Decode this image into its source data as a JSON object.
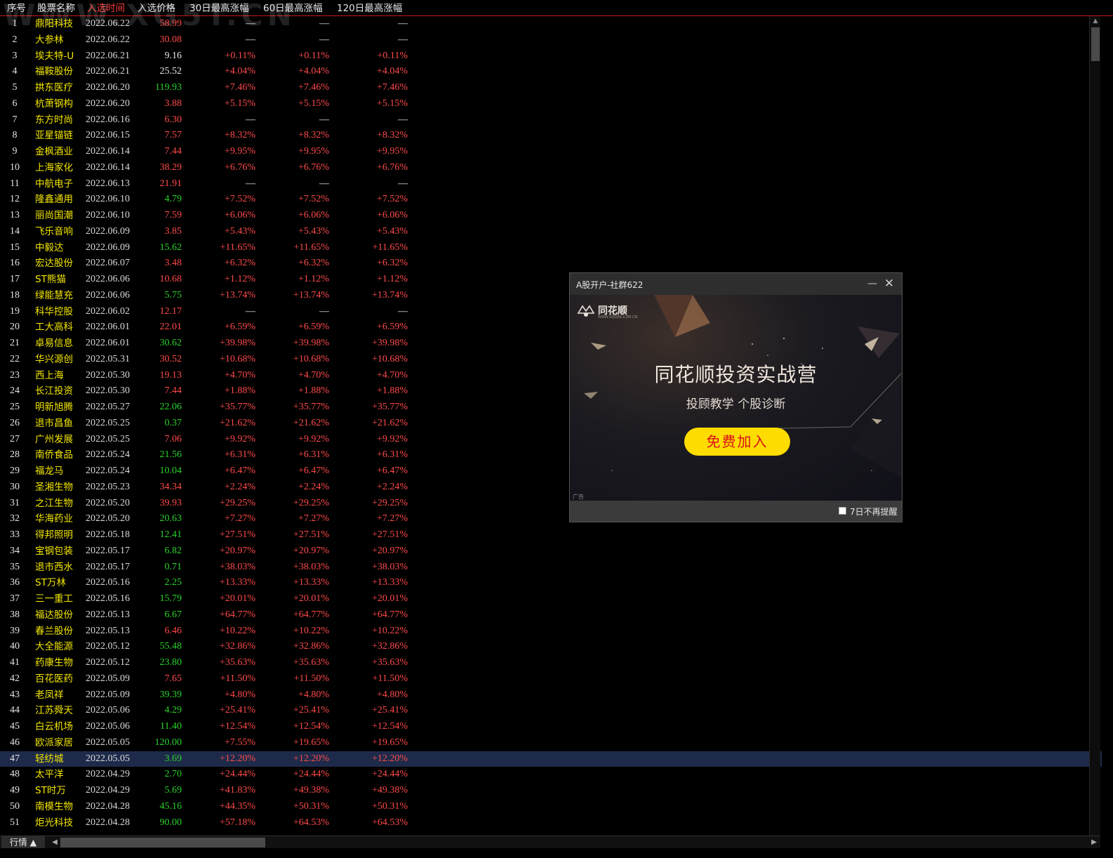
{
  "watermark": "WWW.XG5T.CN",
  "header": {
    "columns": [
      "序号",
      "股票名称",
      "入选时间",
      "入选价格",
      "30日最高涨幅",
      "60日最高涨幅",
      "120日最高涨幅"
    ]
  },
  "colors": {
    "up": "#ff4a4a",
    "down": "#2bd22b",
    "name": "#f2e600",
    "selected_row": "#1e2a4a",
    "header_active": "#ff3c3c"
  },
  "selected_index": 46,
  "rows": [
    {
      "idx": "1",
      "name": "鼎阳科技",
      "date": "2022.06.22",
      "price": "58.99",
      "dir": "up",
      "g30": "—",
      "g60": "—",
      "g120": "—"
    },
    {
      "idx": "2",
      "name": "大参林",
      "date": "2022.06.22",
      "price": "30.08",
      "dir": "up",
      "g30": "—",
      "g60": "—",
      "g120": "—"
    },
    {
      "idx": "3",
      "name": "埃夫特-U",
      "date": "2022.06.21",
      "price": "9.16",
      "dir": "flat",
      "g30": "+0.11%",
      "g60": "+0.11%",
      "g120": "+0.11%"
    },
    {
      "idx": "4",
      "name": "福鞍股份",
      "date": "2022.06.21",
      "price": "25.52",
      "dir": "flat",
      "g30": "+4.04%",
      "g60": "+4.04%",
      "g120": "+4.04%"
    },
    {
      "idx": "5",
      "name": "拱东医疗",
      "date": "2022.06.20",
      "price": "119.93",
      "dir": "down",
      "g30": "+7.46%",
      "g60": "+7.46%",
      "g120": "+7.46%"
    },
    {
      "idx": "6",
      "name": "杭萧钢构",
      "date": "2022.06.20",
      "price": "3.88",
      "dir": "up",
      "g30": "+5.15%",
      "g60": "+5.15%",
      "g120": "+5.15%"
    },
    {
      "idx": "7",
      "name": "东方时尚",
      "date": "2022.06.16",
      "price": "6.30",
      "dir": "up",
      "g30": "—",
      "g60": "—",
      "g120": "—"
    },
    {
      "idx": "8",
      "name": "亚星锚链",
      "date": "2022.06.15",
      "price": "7.57",
      "dir": "up",
      "g30": "+8.32%",
      "g60": "+8.32%",
      "g120": "+8.32%"
    },
    {
      "idx": "9",
      "name": "金枫酒业",
      "date": "2022.06.14",
      "price": "7.44",
      "dir": "up",
      "g30": "+9.95%",
      "g60": "+9.95%",
      "g120": "+9.95%"
    },
    {
      "idx": "10",
      "name": "上海家化",
      "date": "2022.06.14",
      "price": "38.29",
      "dir": "up",
      "g30": "+6.76%",
      "g60": "+6.76%",
      "g120": "+6.76%"
    },
    {
      "idx": "11",
      "name": "中航电子",
      "date": "2022.06.13",
      "price": "21.91",
      "dir": "up",
      "g30": "—",
      "g60": "—",
      "g120": "—"
    },
    {
      "idx": "12",
      "name": "隆鑫通用",
      "date": "2022.06.10",
      "price": "4.79",
      "dir": "down",
      "g30": "+7.52%",
      "g60": "+7.52%",
      "g120": "+7.52%"
    },
    {
      "idx": "13",
      "name": "丽尚国潮",
      "date": "2022.06.10",
      "price": "7.59",
      "dir": "up",
      "g30": "+6.06%",
      "g60": "+6.06%",
      "g120": "+6.06%"
    },
    {
      "idx": "14",
      "name": "飞乐音响",
      "date": "2022.06.09",
      "price": "3.85",
      "dir": "up",
      "g30": "+5.43%",
      "g60": "+5.43%",
      "g120": "+5.43%"
    },
    {
      "idx": "15",
      "name": "中毅达",
      "date": "2022.06.09",
      "price": "15.62",
      "dir": "down",
      "g30": "+11.65%",
      "g60": "+11.65%",
      "g120": "+11.65%"
    },
    {
      "idx": "16",
      "name": "宏达股份",
      "date": "2022.06.07",
      "price": "3.48",
      "dir": "up",
      "g30": "+6.32%",
      "g60": "+6.32%",
      "g120": "+6.32%"
    },
    {
      "idx": "17",
      "name": "ST熊猫",
      "date": "2022.06.06",
      "price": "10.68",
      "dir": "up",
      "g30": "+1.12%",
      "g60": "+1.12%",
      "g120": "+1.12%"
    },
    {
      "idx": "18",
      "name": "绿能慧充",
      "date": "2022.06.06",
      "price": "5.75",
      "dir": "down",
      "g30": "+13.74%",
      "g60": "+13.74%",
      "g120": "+13.74%"
    },
    {
      "idx": "19",
      "name": "科华控股",
      "date": "2022.06.02",
      "price": "12.17",
      "dir": "up",
      "g30": "—",
      "g60": "—",
      "g120": "—"
    },
    {
      "idx": "20",
      "name": "工大高科",
      "date": "2022.06.01",
      "price": "22.01",
      "dir": "up",
      "g30": "+6.59%",
      "g60": "+6.59%",
      "g120": "+6.59%"
    },
    {
      "idx": "21",
      "name": "卓易信息",
      "date": "2022.06.01",
      "price": "30.62",
      "dir": "down",
      "g30": "+39.98%",
      "g60": "+39.98%",
      "g120": "+39.98%"
    },
    {
      "idx": "22",
      "name": "华兴源创",
      "date": "2022.05.31",
      "price": "30.52",
      "dir": "up",
      "g30": "+10.68%",
      "g60": "+10.68%",
      "g120": "+10.68%"
    },
    {
      "idx": "23",
      "name": "西上海",
      "date": "2022.05.30",
      "price": "19.13",
      "dir": "up",
      "g30": "+4.70%",
      "g60": "+4.70%",
      "g120": "+4.70%"
    },
    {
      "idx": "24",
      "name": "长江投资",
      "date": "2022.05.30",
      "price": "7.44",
      "dir": "up",
      "g30": "+1.88%",
      "g60": "+1.88%",
      "g120": "+1.88%"
    },
    {
      "idx": "25",
      "name": "明新旭腾",
      "date": "2022.05.27",
      "price": "22.06",
      "dir": "down",
      "g30": "+35.77%",
      "g60": "+35.77%",
      "g120": "+35.77%"
    },
    {
      "idx": "26",
      "name": "退市昌鱼",
      "date": "2022.05.25",
      "price": "0.37",
      "dir": "down",
      "g30": "+21.62%",
      "g60": "+21.62%",
      "g120": "+21.62%"
    },
    {
      "idx": "27",
      "name": "广州发展",
      "date": "2022.05.25",
      "price": "7.06",
      "dir": "up",
      "g30": "+9.92%",
      "g60": "+9.92%",
      "g120": "+9.92%"
    },
    {
      "idx": "28",
      "name": "南侨食品",
      "date": "2022.05.24",
      "price": "21.56",
      "dir": "down",
      "g30": "+6.31%",
      "g60": "+6.31%",
      "g120": "+6.31%"
    },
    {
      "idx": "29",
      "name": "福龙马",
      "date": "2022.05.24",
      "price": "10.04",
      "dir": "down",
      "g30": "+6.47%",
      "g60": "+6.47%",
      "g120": "+6.47%"
    },
    {
      "idx": "30",
      "name": "圣湘生物",
      "date": "2022.05.23",
      "price": "34.34",
      "dir": "up",
      "g30": "+2.24%",
      "g60": "+2.24%",
      "g120": "+2.24%"
    },
    {
      "idx": "31",
      "name": "之江生物",
      "date": "2022.05.20",
      "price": "39.93",
      "dir": "up",
      "g30": "+29.25%",
      "g60": "+29.25%",
      "g120": "+29.25%"
    },
    {
      "idx": "32",
      "name": "华海药业",
      "date": "2022.05.20",
      "price": "20.63",
      "dir": "down",
      "g30": "+7.27%",
      "g60": "+7.27%",
      "g120": "+7.27%"
    },
    {
      "idx": "33",
      "name": "得邦照明",
      "date": "2022.05.18",
      "price": "12.41",
      "dir": "down",
      "g30": "+27.51%",
      "g60": "+27.51%",
      "g120": "+27.51%"
    },
    {
      "idx": "34",
      "name": "宝钢包装",
      "date": "2022.05.17",
      "price": "6.82",
      "dir": "down",
      "g30": "+20.97%",
      "g60": "+20.97%",
      "g120": "+20.97%"
    },
    {
      "idx": "35",
      "name": "退市西水",
      "date": "2022.05.17",
      "price": "0.71",
      "dir": "down",
      "g30": "+38.03%",
      "g60": "+38.03%",
      "g120": "+38.03%"
    },
    {
      "idx": "36",
      "name": "ST万林",
      "date": "2022.05.16",
      "price": "2.25",
      "dir": "down",
      "g30": "+13.33%",
      "g60": "+13.33%",
      "g120": "+13.33%"
    },
    {
      "idx": "37",
      "name": "三一重工",
      "date": "2022.05.16",
      "price": "15.79",
      "dir": "down",
      "g30": "+20.01%",
      "g60": "+20.01%",
      "g120": "+20.01%"
    },
    {
      "idx": "38",
      "name": "福达股份",
      "date": "2022.05.13",
      "price": "6.67",
      "dir": "down",
      "g30": "+64.77%",
      "g60": "+64.77%",
      "g120": "+64.77%"
    },
    {
      "idx": "39",
      "name": "春兰股份",
      "date": "2022.05.13",
      "price": "6.46",
      "dir": "up",
      "g30": "+10.22%",
      "g60": "+10.22%",
      "g120": "+10.22%"
    },
    {
      "idx": "40",
      "name": "大全能源",
      "date": "2022.05.12",
      "price": "55.48",
      "dir": "down",
      "g30": "+32.86%",
      "g60": "+32.86%",
      "g120": "+32.86%"
    },
    {
      "idx": "41",
      "name": "药康生物",
      "date": "2022.05.12",
      "price": "23.80",
      "dir": "down",
      "g30": "+35.63%",
      "g60": "+35.63%",
      "g120": "+35.63%"
    },
    {
      "idx": "42",
      "name": "百花医药",
      "date": "2022.05.09",
      "price": "7.65",
      "dir": "up",
      "g30": "+11.50%",
      "g60": "+11.50%",
      "g120": "+11.50%"
    },
    {
      "idx": "43",
      "name": "老凤祥",
      "date": "2022.05.09",
      "price": "39.39",
      "dir": "down",
      "g30": "+4.80%",
      "g60": "+4.80%",
      "g120": "+4.80%"
    },
    {
      "idx": "44",
      "name": "江苏舜天",
      "date": "2022.05.06",
      "price": "4.29",
      "dir": "down",
      "g30": "+25.41%",
      "g60": "+25.41%",
      "g120": "+25.41%"
    },
    {
      "idx": "45",
      "name": "白云机场",
      "date": "2022.05.06",
      "price": "11.40",
      "dir": "down",
      "g30": "+12.54%",
      "g60": "+12.54%",
      "g120": "+12.54%"
    },
    {
      "idx": "46",
      "name": "欧派家居",
      "date": "2022.05.05",
      "price": "120.00",
      "dir": "down",
      "g30": "+7.55%",
      "g60": "+19.65%",
      "g120": "+19.65%"
    },
    {
      "idx": "47",
      "name": "轻纺城",
      "date": "2022.05.05",
      "price": "3.69",
      "dir": "down",
      "g30": "+12.20%",
      "g60": "+12.20%",
      "g120": "+12.20%"
    },
    {
      "idx": "48",
      "name": "太平洋",
      "date": "2022.04.29",
      "price": "2.70",
      "dir": "down",
      "g30": "+24.44%",
      "g60": "+24.44%",
      "g120": "+24.44%"
    },
    {
      "idx": "49",
      "name": "ST时万",
      "date": "2022.04.29",
      "price": "5.69",
      "dir": "down",
      "g30": "+41.83%",
      "g60": "+49.38%",
      "g120": "+49.38%"
    },
    {
      "idx": "50",
      "name": "南模生物",
      "date": "2022.04.28",
      "price": "45.16",
      "dir": "down",
      "g30": "+44.35%",
      "g60": "+50.31%",
      "g120": "+50.31%"
    },
    {
      "idx": "51",
      "name": "炬光科技",
      "date": "2022.04.28",
      "price": "90.00",
      "dir": "down",
      "g30": "+57.18%",
      "g60": "+64.53%",
      "g120": "+64.53%"
    }
  ],
  "statusbar": {
    "tab_label": "行情 ▲"
  },
  "popup": {
    "title": "A股开户-社群622",
    "minimize_glyph": "—",
    "close_glyph": "✕",
    "logo_text": "同花顺",
    "logo_sub": "WWW.10JQKA.COM.CN",
    "headline": "同花顺投资实战营",
    "subheadline": "投顾教学 个股诊断",
    "cta": "免费加入",
    "ad_tag": "广告",
    "checkbox_label": "7日不再提醒"
  }
}
